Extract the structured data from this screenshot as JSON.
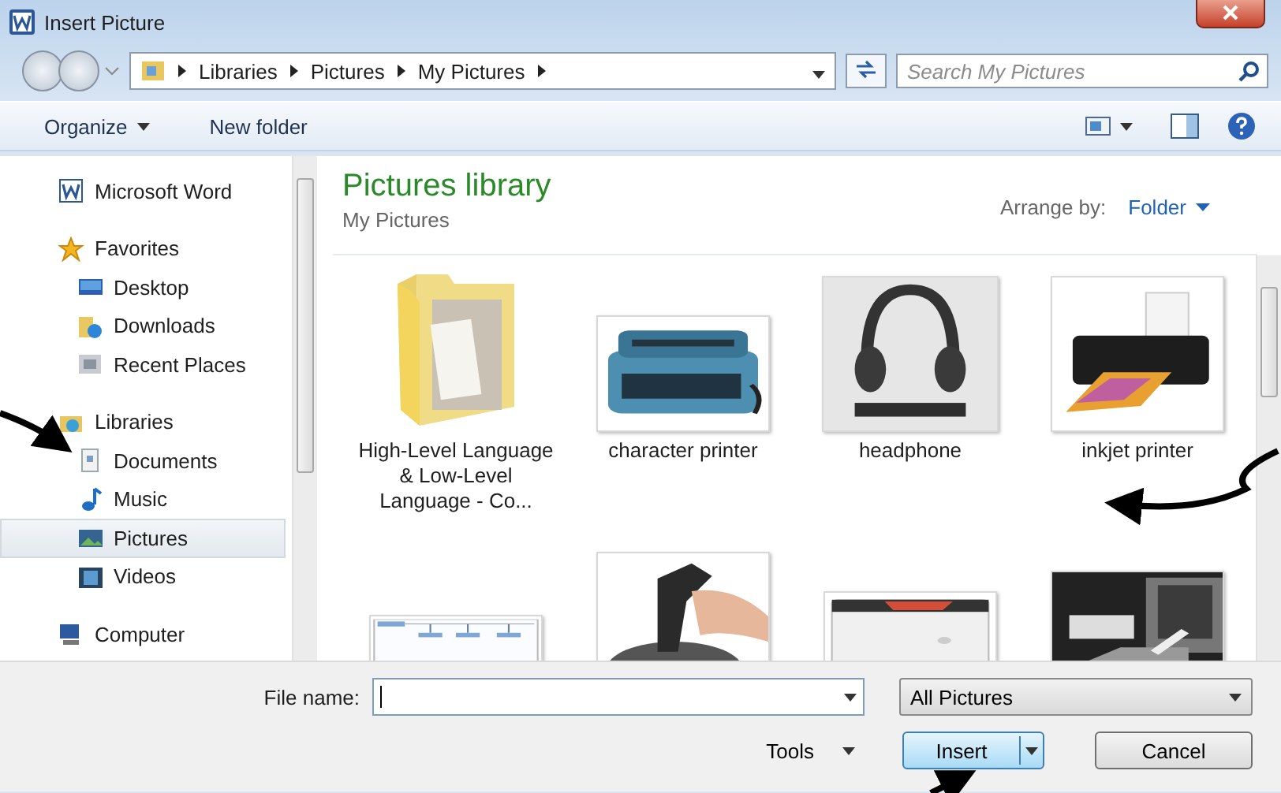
{
  "window": {
    "title": "Insert Picture"
  },
  "address": {
    "path": [
      "Libraries",
      "Pictures",
      "My Pictures"
    ]
  },
  "search": {
    "placeholder": "Search My Pictures"
  },
  "toolbar": {
    "items": [
      "Organize",
      "New folder"
    ]
  },
  "sidebar": {
    "items": [
      {
        "label": "Microsoft Word",
        "selected": false
      },
      {
        "label": "Favorites",
        "selected": false,
        "children": [
          {
            "label": "Desktop",
            "selected": false
          },
          {
            "label": "Downloads",
            "selected": false
          },
          {
            "label": "Recent Places",
            "selected": false
          }
        ]
      },
      {
        "label": "Libraries",
        "selected": false,
        "children": [
          {
            "label": "Documents",
            "selected": false
          },
          {
            "label": "Music",
            "selected": false
          },
          {
            "label": "Pictures",
            "selected": true
          },
          {
            "label": "Videos",
            "selected": false
          }
        ]
      },
      {
        "label": "Computer",
        "selected": false
      }
    ]
  },
  "library": {
    "title": "Pictures library",
    "subtitle": "My Pictures",
    "arrange_label": "Arrange by:",
    "arrange_value": "Folder"
  },
  "items": [
    {
      "kind": "folder",
      "label": "High-Level Language & Low-Level Language - Co..."
    },
    {
      "kind": "picture",
      "label": "character printer"
    },
    {
      "kind": "picture",
      "label": "headphone"
    },
    {
      "kind": "picture",
      "label": "inkjet printer"
    },
    {
      "kind": "picture"
    },
    {
      "kind": "picture"
    },
    {
      "kind": "picture"
    },
    {
      "kind": "picture"
    }
  ],
  "footer": {
    "file_name_label": "File name:",
    "file_type": "All Pictures",
    "tools": "Tools",
    "buttons": [
      "Insert",
      "Cancel"
    ]
  }
}
